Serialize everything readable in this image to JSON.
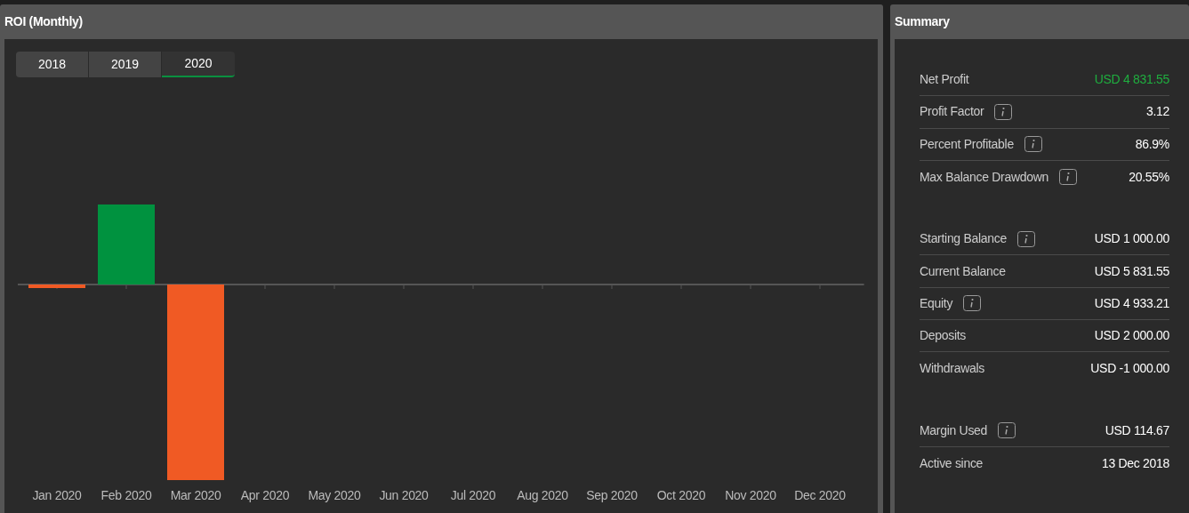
{
  "roi_panel": {
    "title": "ROI (Monthly)",
    "year_tabs": [
      {
        "label": "2018",
        "selected": false
      },
      {
        "label": "2019",
        "selected": false
      },
      {
        "label": "2020",
        "selected": true
      }
    ],
    "months": [
      "Jan 2020",
      "Feb 2020",
      "Mar 2020",
      "Apr 2020",
      "May 2020",
      "Jun 2020",
      "Jul 2020",
      "Aug 2020",
      "Sep 2020",
      "Oct 2020",
      "Nov 2020",
      "Dec 2020"
    ]
  },
  "summary_panel": {
    "title": "Summary",
    "groups": [
      {
        "rows": [
          {
            "label": "Net Profit",
            "value": "USD 4 831.55",
            "info": false,
            "highlight": true
          },
          {
            "label": "Profit Factor",
            "value": "3.12",
            "info": true,
            "highlight": false
          },
          {
            "label": "Percent Profitable",
            "value": "86.9%",
            "info": true,
            "highlight": false
          },
          {
            "label": "Max Balance Drawdown",
            "value": "20.55%",
            "info": true,
            "highlight": false
          }
        ]
      },
      {
        "rows": [
          {
            "label": "Starting Balance",
            "value": "USD 1 000.00",
            "info": true,
            "highlight": false
          },
          {
            "label": "Current Balance",
            "value": "USD 5 831.55",
            "info": false,
            "highlight": false
          },
          {
            "label": "Equity",
            "value": "USD 4 933.21",
            "info": true,
            "highlight": false
          },
          {
            "label": "Deposits",
            "value": "USD 2 000.00",
            "info": false,
            "highlight": false
          },
          {
            "label": "Withdrawals",
            "value": "USD -1 000.00",
            "info": false,
            "highlight": false
          }
        ]
      },
      {
        "rows": [
          {
            "label": "Margin Used",
            "value": "USD 114.67",
            "info": true,
            "highlight": false
          },
          {
            "label": "Active since",
            "value": "13 Dec 2018",
            "info": false,
            "highlight": false
          }
        ]
      }
    ]
  }
}
